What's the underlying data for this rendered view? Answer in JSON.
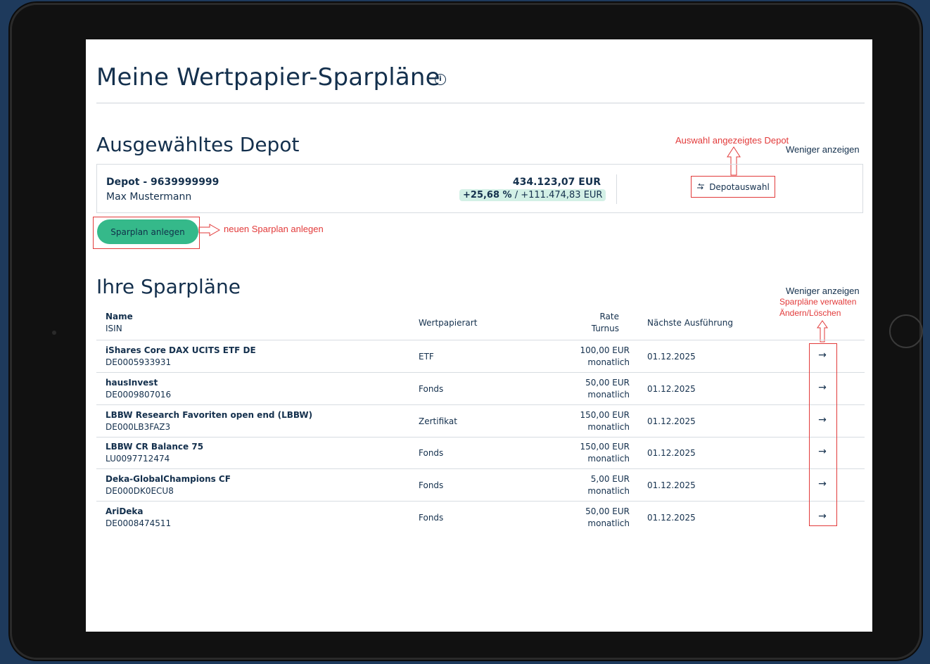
{
  "page": {
    "title": "Meine Wertpapier-Sparpläne",
    "info_icon": "info-icon"
  },
  "depot_section": {
    "heading": "Ausgewähltes Depot",
    "toggle_label": "Weniger anzeigen",
    "depot_label": "Depot - 9639999999",
    "owner": "Max Mustermann",
    "value": "434.123,07 EUR",
    "performance_pct": "+25,68 %",
    "performance_sep": "/",
    "performance_abs": "+111.474,83 EUR",
    "select_button": "Depotauswahl",
    "select_icon": "swap-arrows-icon"
  },
  "actions": {
    "new_plan_button": "Sparplan anlegen"
  },
  "annotations": {
    "depot_select": "Auswahl angezeigtes Depot",
    "new_plan": "neuen Sparplan anlegen",
    "manage_line1": "Sparpläne verwalten",
    "manage_line2": "Ändern/Löschen"
  },
  "plans_section": {
    "heading": "Ihre Sparpläne",
    "toggle_label": "Weniger anzeigen",
    "columns": {
      "name": "Name",
      "isin": "ISIN",
      "type": "Wertpapierart",
      "rate": "Rate",
      "interval": "Turnus",
      "next": "Nächste Ausführung"
    },
    "rows": [
      {
        "name": "iShares Core DAX UCITS ETF DE",
        "isin": "DE0005933931",
        "type": "ETF",
        "rate": "100,00 EUR",
        "interval": "monatlich",
        "next": "01.12.2025"
      },
      {
        "name": "hausInvest",
        "isin": "DE0009807016",
        "type": "Fonds",
        "rate": "50,00 EUR",
        "interval": "monatlich",
        "next": "01.12.2025"
      },
      {
        "name": "LBBW Research Favoriten open end (LBBW)",
        "isin": "DE000LB3FAZ3",
        "type": "Zertifikat",
        "rate": "150,00 EUR",
        "interval": "monatlich",
        "next": "01.12.2025"
      },
      {
        "name": "LBBW CR Balance 75",
        "isin": "LU0097712474",
        "type": "Fonds",
        "rate": "150,00 EUR",
        "interval": "monatlich",
        "next": "01.12.2025"
      },
      {
        "name": "Deka-GlobalChampions CF",
        "isin": "DE000DK0ECU8",
        "type": "Fonds",
        "rate": "5,00 EUR",
        "interval": "monatlich",
        "next": "01.12.2025"
      },
      {
        "name": "AriDeka",
        "isin": "DE0008474511",
        "type": "Fonds",
        "rate": "50,00 EUR",
        "interval": "monatlich",
        "next": "01.12.2025"
      }
    ],
    "row_action_icon": "arrow-right-icon"
  },
  "colors": {
    "primary_text": "#14304d",
    "accent_green": "#35b98a",
    "performance_bg": "#d3f0e6",
    "annotation_red": "#e23a3a",
    "background": "#1e3a5c"
  }
}
